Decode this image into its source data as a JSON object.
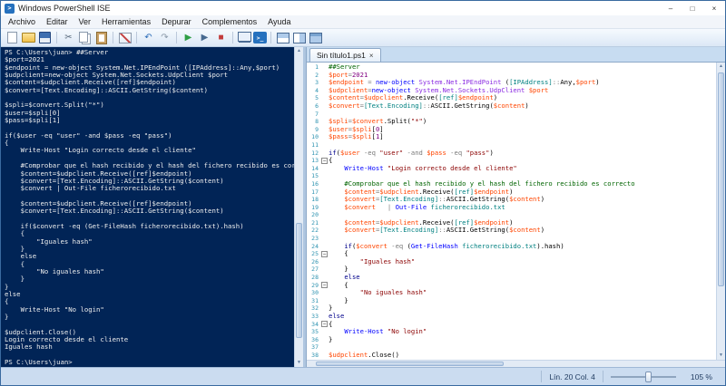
{
  "window": {
    "title": "Windows PowerShell ISE",
    "controls": {
      "minimize": "–",
      "maximize": "□",
      "close": "×"
    },
    "icon_glyph": ">"
  },
  "menu": {
    "items": [
      "Archivo",
      "Editar",
      "Ver",
      "Herramientas",
      "Depurar",
      "Complementos",
      "Ayuda"
    ]
  },
  "toolbar": {
    "items": [
      {
        "name": "new-script-icon"
      },
      {
        "name": "open-script-icon"
      },
      {
        "name": "save-script-icon"
      },
      {
        "type": "sep"
      },
      {
        "name": "cut-icon",
        "glyph": "✂",
        "color": "#5A6B7D"
      },
      {
        "name": "copy-icon"
      },
      {
        "name": "paste-icon"
      },
      {
        "type": "sep"
      },
      {
        "name": "clear-console-icon"
      },
      {
        "type": "sep"
      },
      {
        "name": "undo-icon",
        "glyph": "↶",
        "color": "#2B6CB8"
      },
      {
        "name": "redo-icon",
        "glyph": "↷",
        "color": "#8A99A8"
      },
      {
        "type": "sep"
      },
      {
        "name": "run-script-icon",
        "glyph": "▶",
        "color": "#2E9E44"
      },
      {
        "name": "run-selection-icon",
        "glyph": "▶",
        "color": "#46698F"
      },
      {
        "name": "stop-icon",
        "glyph": "■",
        "color": "#C23B3B"
      },
      {
        "type": "sep"
      },
      {
        "name": "remote-tab-icon"
      },
      {
        "name": "powershell-icon",
        "glyph": ">_",
        "color": "#FFFFFF"
      },
      {
        "type": "sep"
      },
      {
        "name": "pane-top-icon"
      },
      {
        "name": "pane-right-icon"
      },
      {
        "name": "pane-max-icon"
      }
    ]
  },
  "console": {
    "lines": [
      "PS C:\\Users\\juan> ##Server",
      "$port=2021",
      "$endpoint = new-object System.Net.IPEndPoint ([IPAddress]::Any,$port)",
      "$udpclient=new-object System.Net.Sockets.UdpClient $port",
      "$content=$udpclient.Receive([ref]$endpoint)",
      "$convert=[Text.Encoding]::ASCII.GetString($content)",
      "",
      "$spli=$convert.Split(\"*\")",
      "$user=$spli[0]",
      "$pass=$spli[1]",
      "",
      "if($user -eq \"user\" -and $pass -eq \"pass\")",
      "{",
      "    Write-Host \"Login correcto desde el cliente\"",
      "",
      "    #Comprobar que el hash recibido y el hash del fichero recibido es correcto",
      "    $content=$udpclient.Receive([ref]$endpoint)",
      "    $convert=[Text.Encoding]::ASCII.GetString($content)",
      "    $convert | Out-File ficherorecibido.txt",
      "",
      "    $content=$udpclient.Receive([ref]$endpoint)",
      "    $convert=[Text.Encoding]::ASCII.GetString($content)",
      "",
      "    if($convert -eq (Get-FileHash ficherorecibido.txt).hash)",
      "    {",
      "        \"Iguales hash\"",
      "    }",
      "    else",
      "    {",
      "        \"No iguales hash\"",
      "    }",
      "}",
      "else",
      "{",
      "    Write-Host \"No login\"",
      "}",
      "",
      "$udpclient.Close()",
      "Login correcto desde el cliente",
      "Iguales hash",
      "",
      "PS C:\\Users\\juan> "
    ]
  },
  "editor": {
    "tab": {
      "label": "Sin título1.ps1",
      "close": "×"
    },
    "folds": [
      13,
      25,
      29,
      34
    ],
    "lines": [
      [
        [
          "m",
          "##Server"
        ]
      ],
      [
        [
          "v",
          "$port"
        ],
        [
          "o",
          "="
        ],
        [
          "n",
          "2021"
        ]
      ],
      [
        [
          "v",
          "$endpoint"
        ],
        [
          "o",
          " = "
        ],
        [
          "c",
          "new-object"
        ],
        [
          "p",
          " "
        ],
        [
          "a",
          "System.Net.IPEndPoint"
        ],
        [
          "p",
          " ("
        ],
        [
          "t",
          "[IPAddress]"
        ],
        [
          "o",
          "::"
        ],
        [
          "p",
          "Any,"
        ],
        [
          "v",
          "$port"
        ],
        [
          "p",
          ")"
        ]
      ],
      [
        [
          "v",
          "$udpclient"
        ],
        [
          "o",
          "="
        ],
        [
          "c",
          "new-object"
        ],
        [
          "p",
          " "
        ],
        [
          "a",
          "System.Net.Sockets.UdpClient"
        ],
        [
          "p",
          " "
        ],
        [
          "v",
          "$port"
        ]
      ],
      [
        [
          "v",
          "$content"
        ],
        [
          "o",
          "="
        ],
        [
          "v",
          "$udpclient"
        ],
        [
          "p",
          ".Receive("
        ],
        [
          "t",
          "[ref]"
        ],
        [
          "v",
          "$endpoint"
        ],
        [
          "p",
          ")"
        ]
      ],
      [
        [
          "v",
          "$convert"
        ],
        [
          "o",
          "="
        ],
        [
          "t",
          "[Text.Encoding]"
        ],
        [
          "o",
          "::"
        ],
        [
          "p",
          "ASCII.GetString("
        ],
        [
          "v",
          "$content"
        ],
        [
          "p",
          ")"
        ]
      ],
      [],
      [
        [
          "v",
          "$spli"
        ],
        [
          "o",
          "="
        ],
        [
          "v",
          "$convert"
        ],
        [
          "p",
          ".Split("
        ],
        [
          "s",
          "\"*\""
        ],
        [
          "p",
          ")"
        ]
      ],
      [
        [
          "v",
          "$user"
        ],
        [
          "o",
          "="
        ],
        [
          "v",
          "$spli"
        ],
        [
          "p",
          "["
        ],
        [
          "n",
          "0"
        ],
        [
          "p",
          "]"
        ]
      ],
      [
        [
          "v",
          "$pass"
        ],
        [
          "o",
          "="
        ],
        [
          "v",
          "$spli"
        ],
        [
          "p",
          "["
        ],
        [
          "n",
          "1"
        ],
        [
          "p",
          "]"
        ]
      ],
      [],
      [
        [
          "k",
          "if"
        ],
        [
          "p",
          "("
        ],
        [
          "v",
          "$user"
        ],
        [
          "o",
          " -eq "
        ],
        [
          "s",
          "\"user\""
        ],
        [
          "o",
          " -and "
        ],
        [
          "v",
          "$pass"
        ],
        [
          "o",
          " -eq "
        ],
        [
          "s",
          "\"pass\""
        ],
        [
          "p",
          ")"
        ]
      ],
      [
        [
          "p",
          "{"
        ]
      ],
      [
        [
          "p",
          "    "
        ],
        [
          "c",
          "Write-Host"
        ],
        [
          "p",
          " "
        ],
        [
          "s",
          "\"Login correcto desde el cliente\""
        ]
      ],
      [],
      [
        [
          "p",
          "    "
        ],
        [
          "m",
          "#Comprobar que el hash recibido y el hash del fichero recibido es correcto"
        ]
      ],
      [
        [
          "p",
          "    "
        ],
        [
          "v",
          "$content"
        ],
        [
          "o",
          "="
        ],
        [
          "v",
          "$udpclient"
        ],
        [
          "p",
          ".Receive("
        ],
        [
          "t",
          "[ref]"
        ],
        [
          "v",
          "$endpoint"
        ],
        [
          "p",
          ")"
        ]
      ],
      [
        [
          "p",
          "    "
        ],
        [
          "v",
          "$convert"
        ],
        [
          "o",
          "="
        ],
        [
          "t",
          "[Text.Encoding]"
        ],
        [
          "o",
          "::"
        ],
        [
          "p",
          "ASCII.GetString("
        ],
        [
          "v",
          "$content"
        ],
        [
          "p",
          ")"
        ]
      ],
      [
        [
          "p",
          "    "
        ],
        [
          "v",
          "$convert"
        ],
        [
          "p",
          "   "
        ],
        [
          "o",
          "|"
        ],
        [
          "p",
          " "
        ],
        [
          "c",
          "Out-File"
        ],
        [
          "p",
          " "
        ],
        [
          "t",
          "ficherorecibido.txt"
        ]
      ],
      [],
      [
        [
          "p",
          "    "
        ],
        [
          "v",
          "$content"
        ],
        [
          "o",
          "="
        ],
        [
          "v",
          "$udpclient"
        ],
        [
          "p",
          ".Receive("
        ],
        [
          "t",
          "[ref]"
        ],
        [
          "v",
          "$endpoint"
        ],
        [
          "p",
          ")"
        ]
      ],
      [
        [
          "p",
          "    "
        ],
        [
          "v",
          "$convert"
        ],
        [
          "o",
          "="
        ],
        [
          "t",
          "[Text.Encoding]"
        ],
        [
          "o",
          "::"
        ],
        [
          "p",
          "ASCII.GetString("
        ],
        [
          "v",
          "$content"
        ],
        [
          "p",
          ")"
        ]
      ],
      [],
      [
        [
          "p",
          "    "
        ],
        [
          "k",
          "if"
        ],
        [
          "p",
          "("
        ],
        [
          "v",
          "$convert"
        ],
        [
          "o",
          " -eq "
        ],
        [
          "p",
          "("
        ],
        [
          "c",
          "Get-FileHash"
        ],
        [
          "p",
          " "
        ],
        [
          "t",
          "ficherorecibido.txt"
        ],
        [
          "p",
          ").hash)"
        ]
      ],
      [
        [
          "p",
          "    {"
        ]
      ],
      [
        [
          "p",
          "        "
        ],
        [
          "s",
          "\"Iguales hash\""
        ]
      ],
      [
        [
          "p",
          "    }"
        ]
      ],
      [
        [
          "p",
          "    "
        ],
        [
          "k",
          "else"
        ]
      ],
      [
        [
          "p",
          "    {"
        ]
      ],
      [
        [
          "p",
          "        "
        ],
        [
          "s",
          "\"No iguales hash\""
        ]
      ],
      [
        [
          "p",
          "    }"
        ]
      ],
      [
        [
          "p",
          "}"
        ]
      ],
      [
        [
          "k",
          "else"
        ]
      ],
      [
        [
          "p",
          "{"
        ]
      ],
      [
        [
          "p",
          "    "
        ],
        [
          "c",
          "Write-Host"
        ],
        [
          "p",
          " "
        ],
        [
          "s",
          "\"No login\""
        ]
      ],
      [
        [
          "p",
          "}"
        ]
      ],
      [],
      [
        [
          "v",
          "$udpclient"
        ],
        [
          "p",
          ".Close()"
        ]
      ]
    ]
  },
  "statusbar": {
    "line_col": "Lín. 20 Col. 4",
    "zoom": "105 %"
  },
  "colors": {
    "console_bg": "#012456",
    "console_text": "#EFEFEF",
    "tok_variable": "#FF4500",
    "tok_command": "#0000FF",
    "tok_keyword": "#00008B",
    "tok_string": "#8B0000",
    "tok_comment": "#006400",
    "tok_type": "#008080",
    "tok_number": "#800080",
    "tok_operator": "#7A7A7A",
    "tok_plain": "#000000",
    "tok_argument": "#8A2BE2",
    "linenumber": "#2B91AF"
  }
}
